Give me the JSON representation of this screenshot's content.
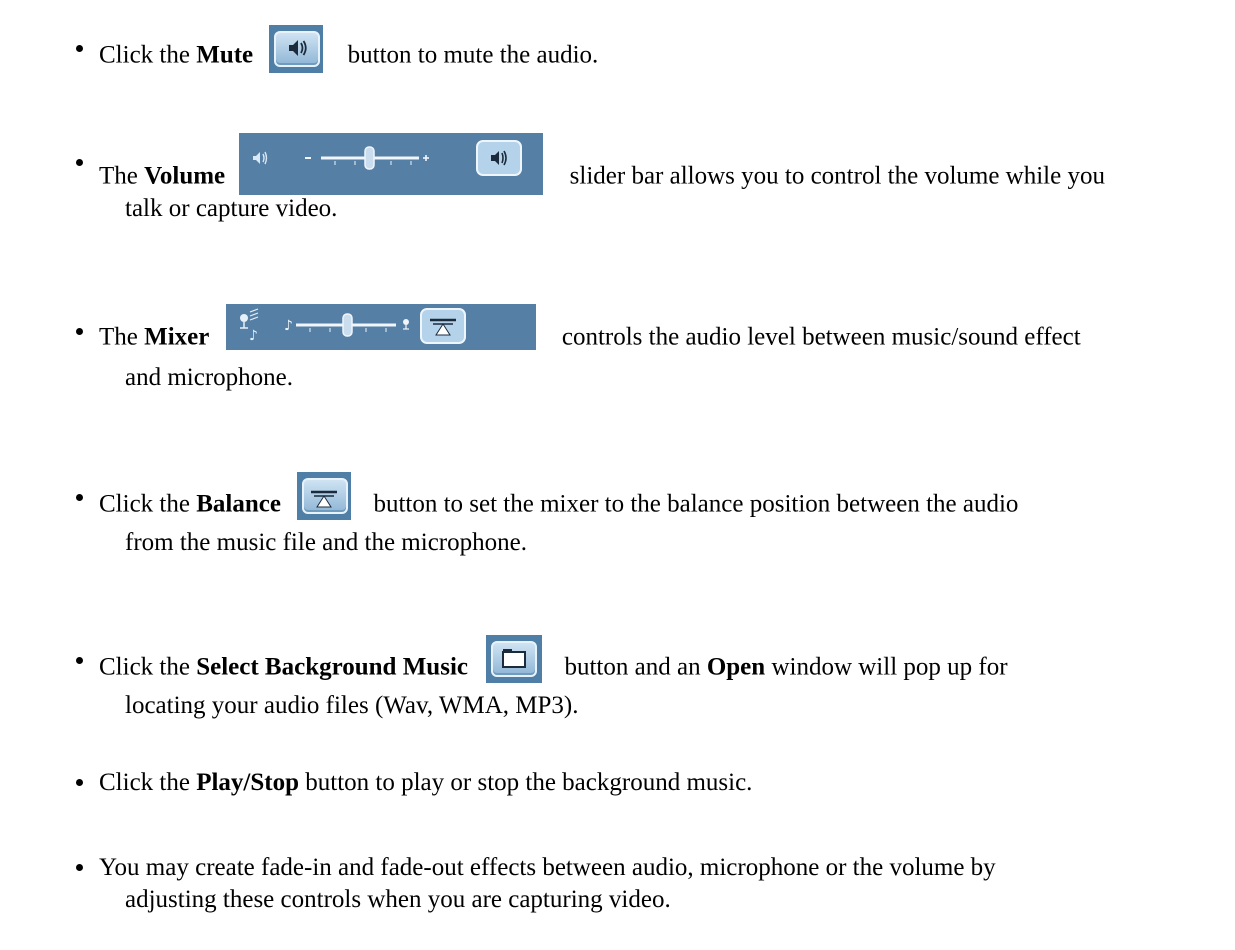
{
  "items": [
    {
      "pre": "Click the ",
      "bold": "Mute",
      "post": " button to mute the audio."
    },
    {
      "pre": "The ",
      "bold": "Volume",
      "post": " slider bar allows you to control the volume while you",
      "cont": "talk or capture video."
    },
    {
      "pre": "The ",
      "bold": "Mixer",
      "post": " controls the audio level between music/sound effect",
      "cont": "and microphone."
    },
    {
      "pre": "Click the ",
      "bold": "Balance",
      "post": " button to set the mixer to the balance position between the audio",
      "cont": "from the music file and the microphone."
    },
    {
      "pre": "Click the ",
      "bold": "Select Background Music",
      "post_a": " button and an ",
      "bold2": "Open",
      "post_b": " window will pop up for",
      "cont": "locating your audio files (Wav, WMA, MP3)."
    },
    {
      "pre": "Click the ",
      "bold": "Play/Stop",
      "post": " button to play or stop the background music."
    },
    {
      "text": "You may create fade-in and fade-out effects between audio, microphone or the volume by",
      "cont": "adjusting these controls when you are capturing video."
    }
  ],
  "icons": {
    "mute": "speaker-icon",
    "volume_bar": "volume-slider-icon",
    "mixer_bar": "mixer-slider-icon",
    "balance": "balance-icon",
    "folder": "folder-icon"
  },
  "controls": {
    "volume_level": 0.5,
    "mixer_level": 0.5
  },
  "colors": {
    "button_bg": "#4f7fa6",
    "bar_bg": "#557fa4",
    "button_face": "#b4d2ea"
  }
}
